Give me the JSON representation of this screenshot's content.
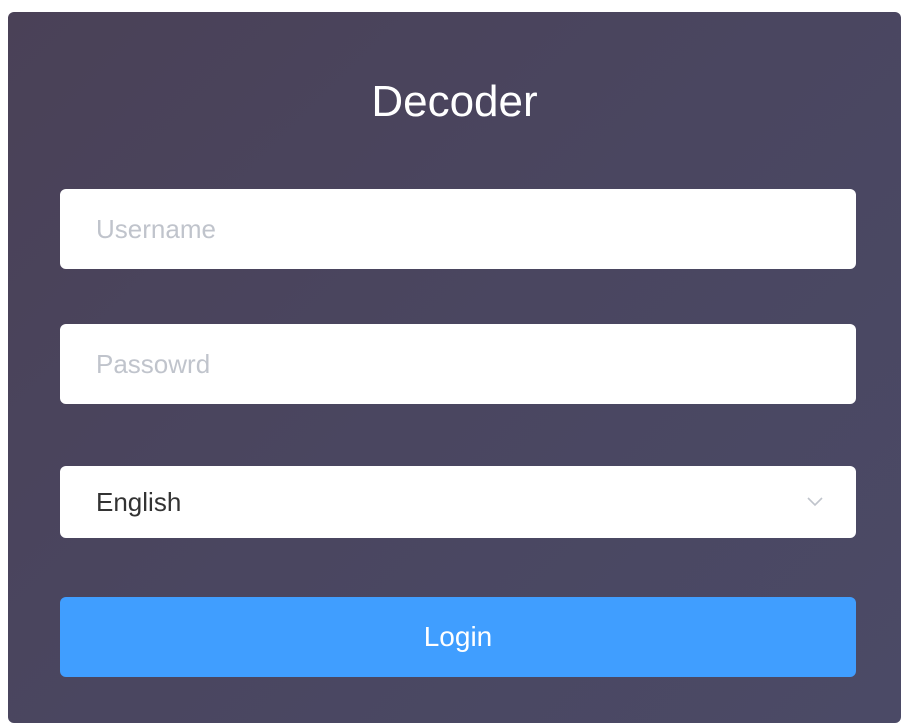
{
  "panel": {
    "title": "Decoder"
  },
  "form": {
    "username": {
      "placeholder": "Username",
      "value": ""
    },
    "password": {
      "placeholder": "Passowrd",
      "value": ""
    },
    "language": {
      "selected": "English"
    },
    "login_label": "Login"
  },
  "icons": {
    "dropdown": "chevron-down-icon"
  },
  "colors": {
    "panel_background": "#4a4660",
    "primary_button": "#409eff",
    "title_text": "#ffffff",
    "placeholder_text": "#c0c4cc"
  }
}
